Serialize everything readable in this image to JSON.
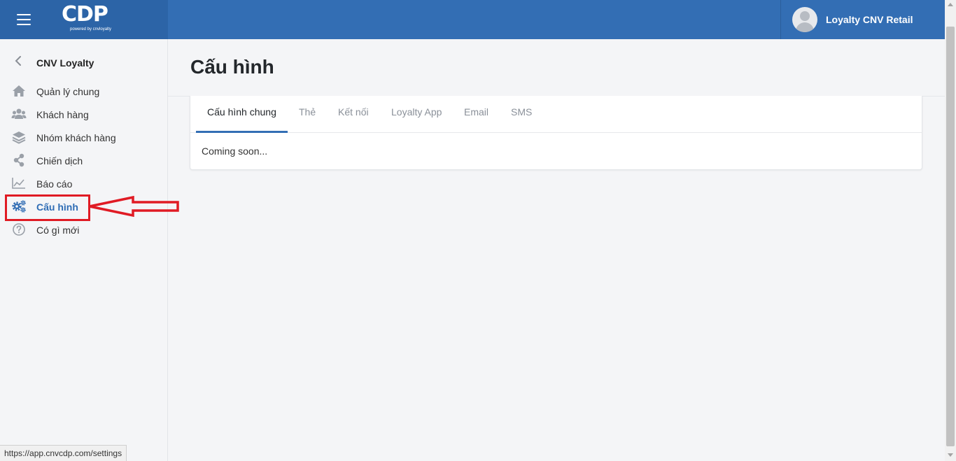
{
  "header": {
    "logo_text": "CDP",
    "logo_subtext": "powered by cnvloyalty",
    "user_name": "Loyalty CNV Retail"
  },
  "sidebar": {
    "title": "CNV Loyalty",
    "items": [
      {
        "label": "Quản lý chung",
        "icon": "home-icon"
      },
      {
        "label": "Khách hàng",
        "icon": "users-icon"
      },
      {
        "label": "Nhóm khách hàng",
        "icon": "layers-icon"
      },
      {
        "label": "Chiến dịch",
        "icon": "share-icon"
      },
      {
        "label": "Báo cáo",
        "icon": "chart-line-icon"
      },
      {
        "label": "Cấu hình",
        "icon": "gears-icon",
        "active": true
      },
      {
        "label": "Có gì mới",
        "icon": "question-circle-icon"
      }
    ]
  },
  "main": {
    "title": "Cấu hình",
    "tabs": [
      {
        "label": "Cấu hình chung",
        "active": true
      },
      {
        "label": "Thẻ"
      },
      {
        "label": "Kết nối"
      },
      {
        "label": "Loyalty App"
      },
      {
        "label": "Email"
      },
      {
        "label": "SMS"
      }
    ],
    "content": "Coming soon..."
  },
  "status_bar": {
    "url": "https://app.cnvcdp.com/settings"
  },
  "colors": {
    "header": "#336eb4",
    "brand": "#2c64a7",
    "active": "#2f6db5",
    "annotation": "#e01b24"
  }
}
